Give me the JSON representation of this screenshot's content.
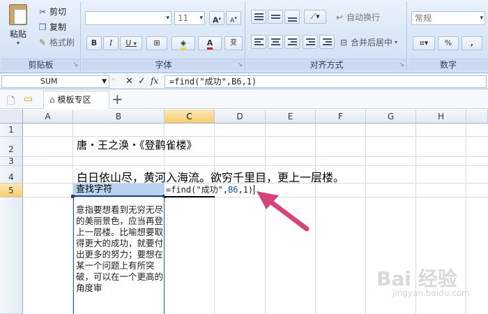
{
  "ribbon": {
    "clipboard": {
      "paste_label": "粘贴",
      "cut_label": "剪切",
      "copy_label": "复制",
      "format_painter_label": "格式刷",
      "group_label": "剪贴板"
    },
    "font": {
      "size_value": "11",
      "bold_glyph": "B",
      "italic_glyph": "I",
      "underline_glyph": "U",
      "grow_glyph": "A",
      "shrink_glyph": "A",
      "font_color_glyph": "A",
      "phonetic_glyph": "变",
      "group_label": "字体"
    },
    "alignment": {
      "wrap_text_label": "自动换行",
      "merge_center_label": "合并后居中",
      "group_label": "对齐方式"
    },
    "number": {
      "format_value": "常规",
      "percent_glyph": "%",
      "comma_glyph": ",",
      "group_label": "数字"
    }
  },
  "formula_bar": {
    "name_box_value": "SUM",
    "cancel_glyph": "✕",
    "enter_glyph": "✓",
    "fx_label": "fx",
    "formula_value": "=find(\"成功\",B6,1)"
  },
  "tabs": {
    "template_tab_label": "模板专区",
    "add_glyph": "+"
  },
  "grid": {
    "columns": [
      "A",
      "B",
      "C",
      "D",
      "E",
      "F",
      "G",
      "H"
    ],
    "rows": [
      "1",
      "2",
      "3",
      "4",
      "5"
    ],
    "selected_column": "C",
    "selected_row": "5",
    "cells": {
      "B2": "唐・王之涣・《登鹳雀楼》",
      "B4": "白日依山尽，黄河入海流。欲穷千里目，更上一层楼。",
      "B5": "查找字符",
      "C5_prefix": "=find(\"成功\",",
      "C5_ref": "B6",
      "C5_suffix": ",1)",
      "B6": "意指要想看到无穷无尽的美丽景色，应当再登上一层楼。比喻想要取得更大的成功，就要付出更多的努力；要想在某一个问题上有所突破，可以在一个更高的角度审"
    }
  },
  "watermark": {
    "text": "Bai 经验",
    "subtext": "jingyan.baidu.com"
  },
  "colors": {
    "arrow": "#d5437a",
    "selection_header": "#f8cd6a",
    "selected_cell_fill": "#b7d3ee",
    "reference_blue": "#1d4ea5"
  }
}
